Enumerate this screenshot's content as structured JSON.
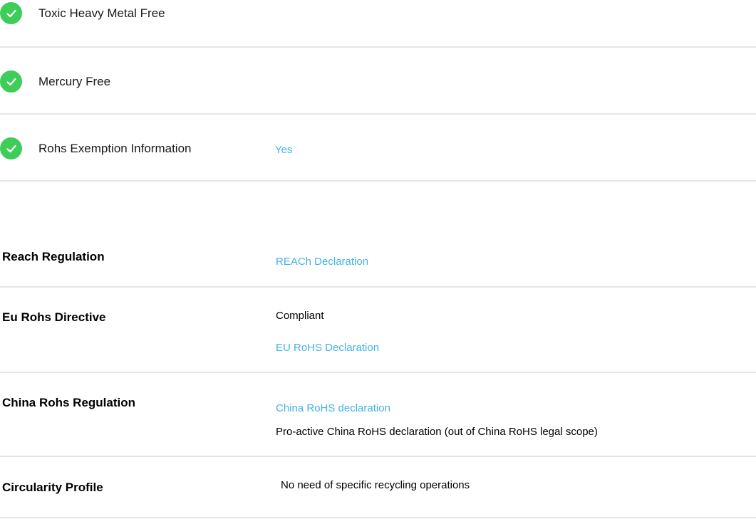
{
  "features": [
    {
      "label": "Toxic Heavy Metal Free",
      "icon": "check-circle-icon"
    },
    {
      "label": "Mercury Free",
      "icon": "check-circle-icon"
    },
    {
      "label": "Rohs Exemption Information",
      "icon": "check-circle-icon",
      "link": "Yes"
    }
  ],
  "regulations": {
    "reach": {
      "label": "Reach Regulation",
      "link": "REACh Declaration"
    },
    "eu_rohs": {
      "label": "Eu Rohs Directive",
      "status": "Compliant",
      "link": "EU RoHS Declaration"
    },
    "china_rohs": {
      "label": "China Rohs Regulation",
      "link": "China RoHS declaration",
      "note": "Pro-active China RoHS declaration (out of China RoHS legal scope)"
    },
    "circularity": {
      "label": "Circularity Profile",
      "value": "No need of specific recycling operations"
    }
  },
  "colors": {
    "check": "#3dcd58",
    "link": "#42b4e6",
    "divider": "#e5e5e5"
  }
}
